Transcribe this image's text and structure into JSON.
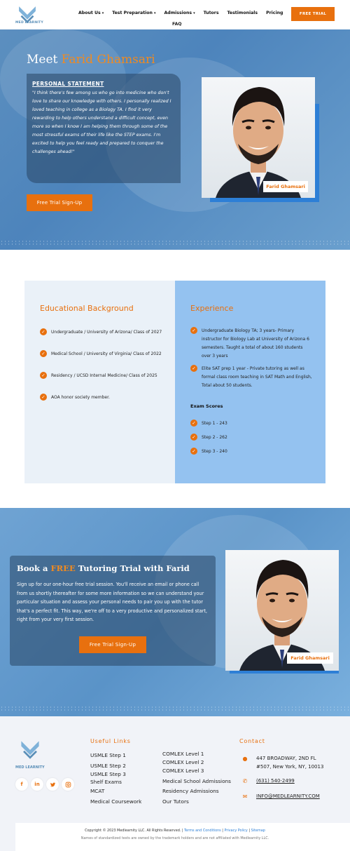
{
  "header": {
    "logo_text": "MED LEARNITY",
    "nav": [
      {
        "label": "About Us",
        "dropdown": true
      },
      {
        "label": "Test Preparation",
        "dropdown": true
      },
      {
        "label": "Admissions",
        "dropdown": true
      },
      {
        "label": "Tutors",
        "dropdown": false
      },
      {
        "label": "Testimonials",
        "dropdown": false
      },
      {
        "label": "Pricing",
        "dropdown": false
      }
    ],
    "faq": "FAQ",
    "cta": "FREE TRIAL"
  },
  "hero": {
    "title_prefix": "Meet ",
    "title_name": "Farid Ghamsari",
    "statement_heading": "PERSONAL STATEMENT",
    "statement_text": "\"I think there's few among us who go into medicine who don't love to share our knowledge with others. I personally realized I loved teaching in college as a Biology TA. I find it very rewarding to help others understand a difficult concept, even more so when I know I am helping them through some of the most stressful exams of their life like the STEP exams. I'm excited to help you feel ready and prepared to conquer the challenges ahead!\"",
    "cta": "Free Trial Sign-Up",
    "photo_tag": "Farid Ghamsari"
  },
  "education": {
    "heading": "Educational Background",
    "items": [
      "Undergraduate / University of Arizona/ Class of 2027",
      "Medical School / University of Virginia/ Class of 2022",
      "Residency / UCSD Internal Medicine/ Class of 2025",
      "AOA honor society member."
    ]
  },
  "experience": {
    "heading": "Experience",
    "items": [
      "Undergraduate Biology TA; 3 years- Primary instructor for Biology Lab at University of Arizona 6 semesters. Taught a total of about 160 students over 3 years",
      "Elite SAT prep 1 year - Private tutoring as well as formal class room teaching in SAT Math and English, Total about 50 students."
    ],
    "scores_heading": "Exam Scores",
    "scores": [
      "Step 1 - 243",
      "Step 2 - 262",
      "Step 3 - 240"
    ]
  },
  "trial": {
    "heading_pre": "Book a ",
    "heading_free": "FREE",
    "heading_post": " Tutoring Trial with Farid",
    "text": "Sign up for our one-hour free trial session. You'll receive an email or phone call from us shortly thereafter for some more information so we can understand your particular situation and assess your personal needs to pair you up with the tutor that's a perfect fit. This way, we're off to a very productive and personalized start, right from your very first session.",
    "cta": "Free Trial Sign-Up",
    "photo_tag": "Farid Ghamsari"
  },
  "footer": {
    "logo_text": "MED LEARNITY",
    "socials": [
      "f",
      "in",
      "t",
      "ig"
    ],
    "useful_links_heading": "Useful Links",
    "links_col1": [
      "USMLE Step 1",
      "USMLE Step 2",
      "USMLE Step 3",
      "Shelf Exams",
      "MCAT",
      "Medical Coursework"
    ],
    "links_col2": [
      "COMLEX Level 1",
      "COMLEX Level 2",
      "COMLEX Level 3",
      "Medical School Admissions",
      "Residency Admissions",
      "Our Tutors"
    ],
    "contact_heading": "Contact",
    "address_line1": "447 BROADWAY, 2ND FL",
    "address_line2": "#507, New York, NY, 10013",
    "phone": "(631) 540-2499",
    "email": "INFO@MEDLEARNITY.COM",
    "copyright": "Copyright © 2023 Medlearnity LLC. All Rights Reserved.",
    "terms": "Terms and Conditions",
    "privacy": "Privacy Policy",
    "sitemap": "Sitemap",
    "disclaimer": "Names of standardized tests are owned by the trademark holders and are not affiliated with Medlearnity LLC."
  },
  "colors": {
    "accent": "#e8700e",
    "brand_blue": "#2d7fd6",
    "exp_bg": "#94c2f0",
    "edu_bg": "#eaf1f8"
  }
}
